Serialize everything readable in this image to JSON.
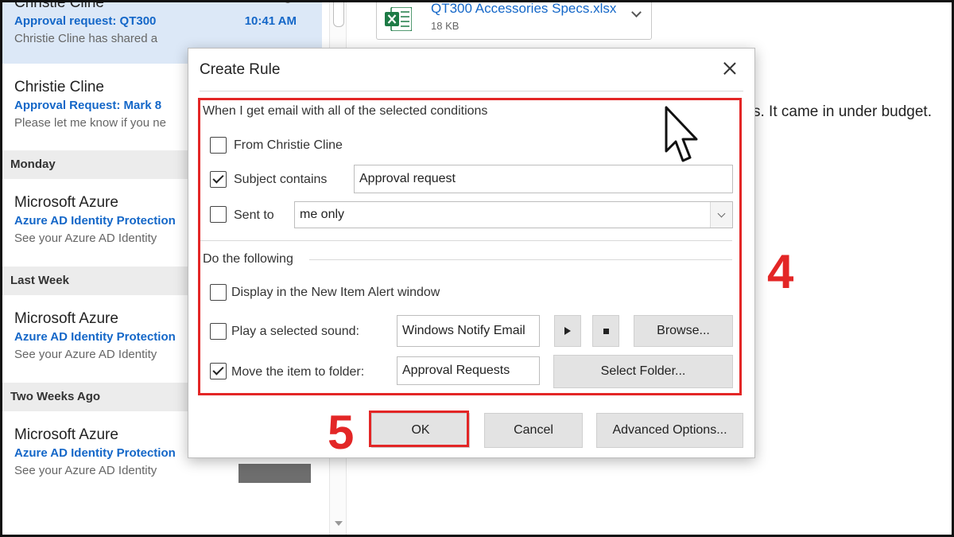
{
  "mail_list": {
    "items": [
      {
        "sender": "Christie Cline",
        "subject": "Approval request: QT300",
        "time": "10:41 AM",
        "preview": "Christie Cline has shared a"
      },
      {
        "sender": "Christie Cline",
        "subject": "Approval Request: Mark 8",
        "preview": "Please let me know if you ne"
      },
      {
        "sender": "Microsoft Azure",
        "subject": "Azure AD Identity Protection",
        "preview": "See your Azure AD Identity"
      },
      {
        "sender": "Microsoft Azure",
        "subject": "Azure AD Identity Protection",
        "preview": "See your Azure AD Identity"
      },
      {
        "sender": "Microsoft Azure",
        "subject": "Azure AD Identity Protection",
        "preview": "See your Azure AD Identity"
      }
    ],
    "groups": [
      "Monday",
      "Last Week",
      "Two Weeks Ago"
    ]
  },
  "reading_pane": {
    "attachment": {
      "name": "QT300 Accessories Specs.xlsx",
      "size": "18 KB",
      "icon": "excel-icon"
    },
    "body_text": "s. It came in under budget."
  },
  "dialog": {
    "title": "Create Rule",
    "conditions_label": "When I get email with all of the selected conditions",
    "from_label": "From Christie Cline",
    "from_checked": false,
    "subject_label": "Subject contains",
    "subject_checked": true,
    "subject_value": "Approval request",
    "sent_to_label": "Sent to",
    "sent_to_checked": false,
    "sent_to_value": "me only",
    "actions_label": "Do the following",
    "display_label": "Display in the New Item Alert window",
    "display_checked": false,
    "sound_label": "Play a selected sound:",
    "sound_checked": false,
    "sound_value": "Windows Notify Email",
    "browse_label": "Browse...",
    "move_label": "Move the item to folder:",
    "move_checked": true,
    "move_value": "Approval Requests",
    "select_folder_label": "Select Folder...",
    "ok_label": "OK",
    "cancel_label": "Cancel",
    "advanced_label": "Advanced Options..."
  },
  "annotations": {
    "step4": "4",
    "step5": "5",
    "color": "#e32626"
  }
}
